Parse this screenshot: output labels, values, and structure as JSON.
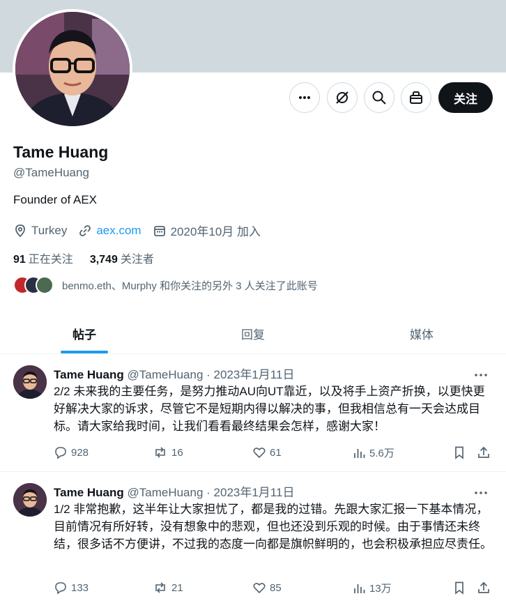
{
  "profile": {
    "name": "Tame Huang",
    "handle": "@TameHuang",
    "bio": "Founder of AEX",
    "location": "Turkey",
    "website": "aex.com",
    "joined": "2020年10月 加入",
    "following_count": "91",
    "following_label": "正在关注",
    "followers_count": "3,749",
    "followers_label": "关注者",
    "known_followers": "benmo.eth、Murphy 和你关注的另外 3 人关注了此账号",
    "follow_button": "关注"
  },
  "icons": [
    "more-icon",
    "grok-icon",
    "search-icon",
    "gift-icon",
    "location-icon",
    "link-icon",
    "calendar-icon",
    "reply-icon",
    "retweet-icon",
    "like-icon",
    "views-icon",
    "bookmark-icon",
    "share-icon"
  ],
  "tabs": [
    {
      "label": "帖子",
      "active": true
    },
    {
      "label": "回复",
      "active": false
    },
    {
      "label": "媒体",
      "active": false
    }
  ],
  "tweets": [
    {
      "name": "Tame Huang",
      "handle_date": "@TameHuang · 2023年1月11日",
      "text": "2/2 未来我的主要任务，是努力推动AU向UT靠近，以及将手上资产折换，以更快更好解决大家的诉求，尽管它不是短期内得以解决的事，但我相信总有一天会达成目标。请大家给我时间，让我们看看最终结果会怎样，感谢大家！",
      "replies": "928",
      "retweets": "16",
      "likes": "61",
      "views": "5.6万"
    },
    {
      "name": "Tame Huang",
      "handle_date": "@TameHuang · 2023年1月11日",
      "text": "1/2 非常抱歉，这半年让大家担忧了，都是我的过错。先跟大家汇报一下基本情况，目前情况有所好转，没有想象中的悲观，但也还没到乐观的时候。由于事情还未终结，很多话不方便讲，不过我的态度一向都是旗帜鲜明的，也会积极承担应尽责任。",
      "replies": "133",
      "retweets": "21",
      "likes": "85",
      "views": "13万"
    }
  ],
  "colors": {
    "banner": "#cfd9de",
    "accent": "#1d9bf0",
    "text_primary": "#0f1419",
    "text_secondary": "#536471"
  }
}
